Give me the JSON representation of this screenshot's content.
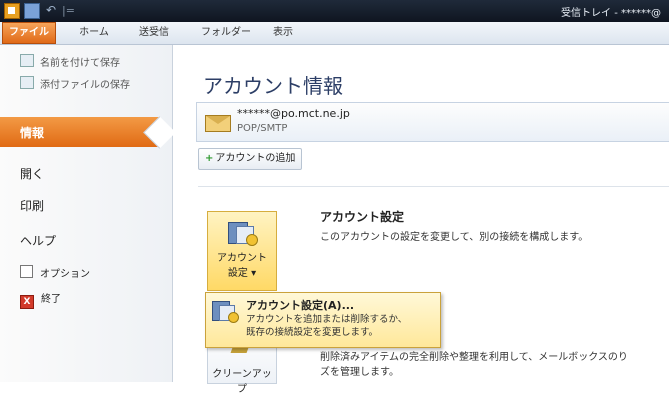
{
  "titlebar": {
    "undo_glyph": "↶",
    "separator": "|=",
    "title": "受信トレイ - ******@"
  },
  "ribbon": {
    "tabs": [
      "ファイル",
      "ホーム",
      "送受信",
      "フォルダー",
      "表示"
    ]
  },
  "nav": {
    "save_as": "名前を付けて保存",
    "save_attachments": "添付ファイルの保存",
    "selected": "情報",
    "items": [
      "開く",
      "印刷",
      "ヘルプ"
    ],
    "options": "オプション",
    "exit": "終了",
    "exit_glyph": "X"
  },
  "main": {
    "title": "アカウント情報",
    "account": {
      "email": "******@po.mct.ne.jp",
      "type": "POP/SMTP"
    },
    "add_account": {
      "plus": "+",
      "label": "アカウントの追加"
    },
    "account_settings": {
      "button_line1": "アカウント",
      "button_line2": "設定 ▾",
      "title": "アカウント設定",
      "description": "このアカウントの設定を変更して、別の接続を構成します。"
    },
    "cleanup": {
      "button_label": "クリーンアップ",
      "title_visible": "理",
      "description_line1": "削除済みアイテムの完全削除や整理を利用して、メールボックスのり",
      "description_line2": "ズを管理します。"
    }
  },
  "popup": {
    "title": "アカウント設定(A)...",
    "description_line1": "アカウントを追加または削除するか、",
    "description_line2": "既存の接続設定を変更します。"
  }
}
